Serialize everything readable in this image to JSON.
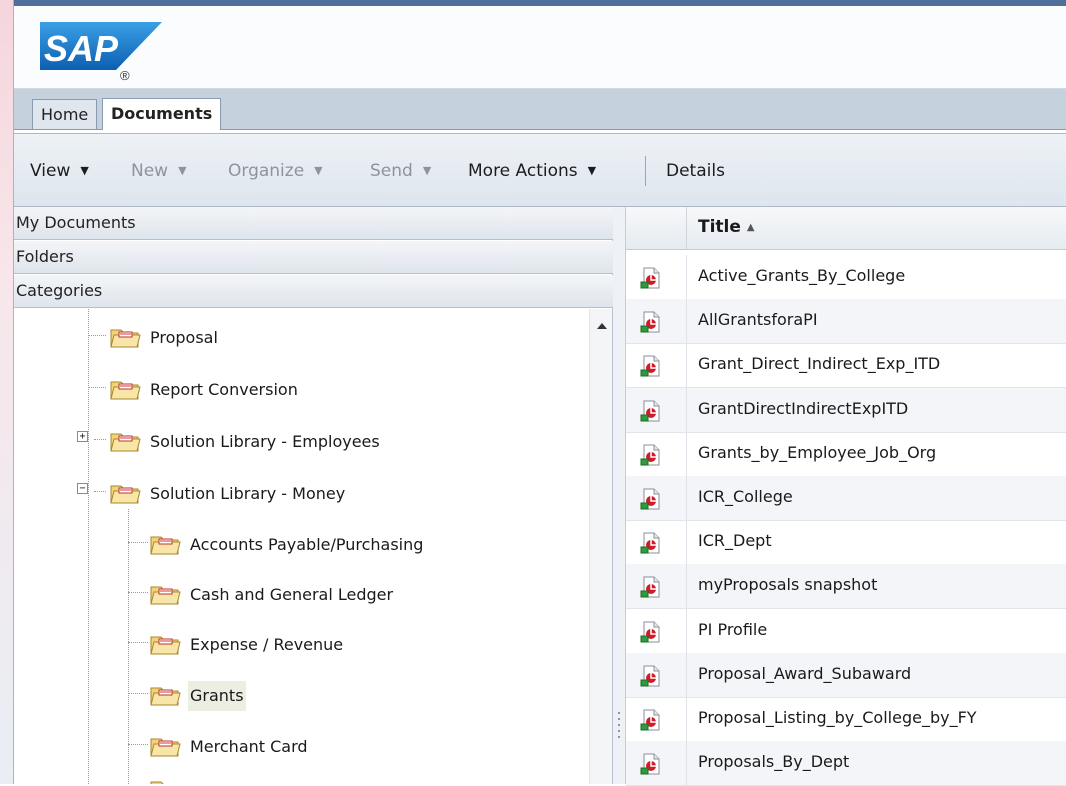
{
  "app": {
    "logo_text": "SAP",
    "logo_mark": "®"
  },
  "tabs": [
    {
      "label": "Home",
      "active": false
    },
    {
      "label": "Documents",
      "active": true
    }
  ],
  "toolbar": {
    "view": "View",
    "new": "New",
    "organize": "Organize",
    "send": "Send",
    "more_actions": "More Actions",
    "details": "Details",
    "caret": "▼"
  },
  "accordion": {
    "my_documents": "My Documents",
    "folders": "Folders",
    "categories": "Categories"
  },
  "tree": [
    {
      "label": "Proposal",
      "level": 1,
      "expander": ""
    },
    {
      "label": "Report Conversion",
      "level": 1,
      "expander": ""
    },
    {
      "label": "Solution Library - Employees",
      "level": 1,
      "expander": "+"
    },
    {
      "label": "Solution Library - Money",
      "level": 1,
      "expander": "−"
    },
    {
      "label": "Accounts Payable/Purchasing",
      "level": 2,
      "expander": ""
    },
    {
      "label": "Cash and General Ledger",
      "level": 2,
      "expander": ""
    },
    {
      "label": "Expense / Revenue",
      "level": 2,
      "expander": ""
    },
    {
      "label": "Grants",
      "level": 2,
      "expander": "",
      "selected": true
    },
    {
      "label": "Merchant Card",
      "level": 2,
      "expander": ""
    }
  ],
  "list": {
    "title_header": "Title",
    "sort_indicator": "▲",
    "rows": [
      "Active_Grants_By_College",
      "AllGrantsforaPI",
      "Grant_Direct_Indirect_Exp_ITD",
      "GrantDirectIndirectExpITD",
      "Grants_by_Employee_Job_Org",
      "ICR_College",
      "ICR_Dept",
      "myProposals snapshot",
      "PI Profile",
      "Proposal_Award_Subaward",
      "Proposal_Listing_by_College_by_FY",
      "Proposals_By_Dept"
    ]
  },
  "colors": {
    "accent": "#4f6f9a",
    "sap_blue": "#1b79c8",
    "doc_icon_red": "#d11a2a"
  },
  "icons": {
    "folder": "folder-icon",
    "document": "report-document-icon",
    "logo": "sap-logo-icon"
  }
}
